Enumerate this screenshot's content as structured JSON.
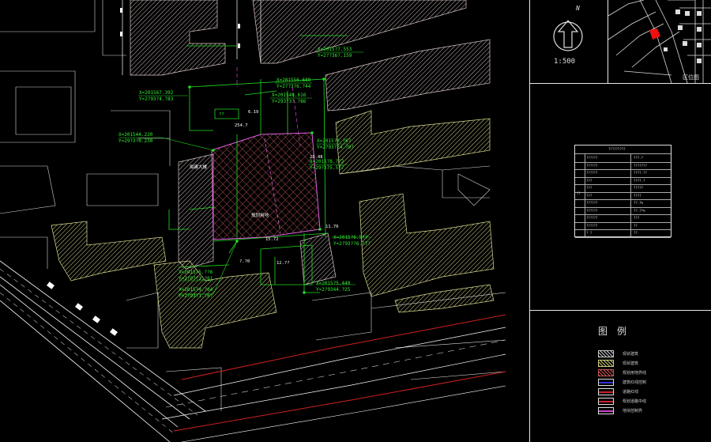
{
  "labels": {
    "coord_1": {
      "x": "X=2015?7.553",
      "y": "Y=2??36?.159"
    },
    "coord_2": {
      "x": "X=201556.688",
      "y": "Y=2??3?6.?44"
    },
    "coord_3": {
      "x": "X=201567.392",
      "y": "Y=2?93?4.?83"
    },
    "coord_4": {
      "x": "X=201548.616",
      "y": "Y=293?3?.?86"
    },
    "coord_5": {
      "x": "X=201544.220",
      "y": "Y=29?3?0.230"
    },
    "coord_6": {
      "x": "X=2015?6.?6?",
      "y": "Y=2?93??4.?9?"
    },
    "coord_7": {
      "x": "X=2015?8.??2",
      "y": "Y=29?375.577"
    },
    "coord_8": {
      "x": "X=2015?6.5??",
      "y": "Y=2?93??6.?7?"
    },
    "coord_9": {
      "x": "X=2015?5.??6",
      "y": "Y=2?9??1.?61"
    },
    "coord_10": {
      "x": "X=2015?4.?64",
      "y": "Y=2?93?1.?6?"
    },
    "coord_11": {
      "x": "X=2015?5.440",
      "y": "Y=2?9344.?25"
    },
    "dim_1": "15.72",
    "dim_2": "11.76",
    "dim_3": "12.??",
    "dim_4": "?.?0",
    "dim_5": "23.48",
    "dim_6": "6.19",
    "dim_7": "254.7",
    "site_label_1": "规划用地",
    "site_label_2": "拟建大楼",
    "site_label_3": "??"
  },
  "title_block": {
    "north_label": "N",
    "scale": "1:500",
    "location_map_caption": "区位图"
  },
  "tech_table": {
    "title": "?????????",
    "rows": [
      {
        "name": "??????",
        "value": "???.?"
      },
      {
        "name": "??????",
        "value": "???????"
      },
      {
        "name": "??????",
        "value": "????.??"
      },
      {
        "name": "???",
        "value": "????.?"
      },
      {
        "name": "???",
        "value": "?????"
      },
      {
        "name": "???",
        "value": "????"
      },
      {
        "name": "??????",
        "value": "??.?%"
      },
      {
        "name": "??????",
        "value": "??.??%"
      },
      {
        "name": "??????",
        "value": "???"
      },
      {
        "name": "??????",
        "value": "??"
      },
      {
        "name": "?  ?",
        "value": "??"
      }
    ],
    "side_label": "??"
  },
  "legend": {
    "title": "图例",
    "items": [
      {
        "label": "现状建筑",
        "color": "#c8c8c8"
      },
      {
        "label": "现状建筑",
        "color": "#c9c97a"
      },
      {
        "label": "规划用地界线",
        "color": "#cc5555"
      },
      {
        "label": "建筑红线控制",
        "color": "#3333cc"
      },
      {
        "label": "道路红线",
        "color": "#cc2222"
      },
      {
        "label": "规划道路中线",
        "color": "#cc2222"
      },
      {
        "label": "地块控制界",
        "color": "#cc44cc"
      }
    ]
  }
}
